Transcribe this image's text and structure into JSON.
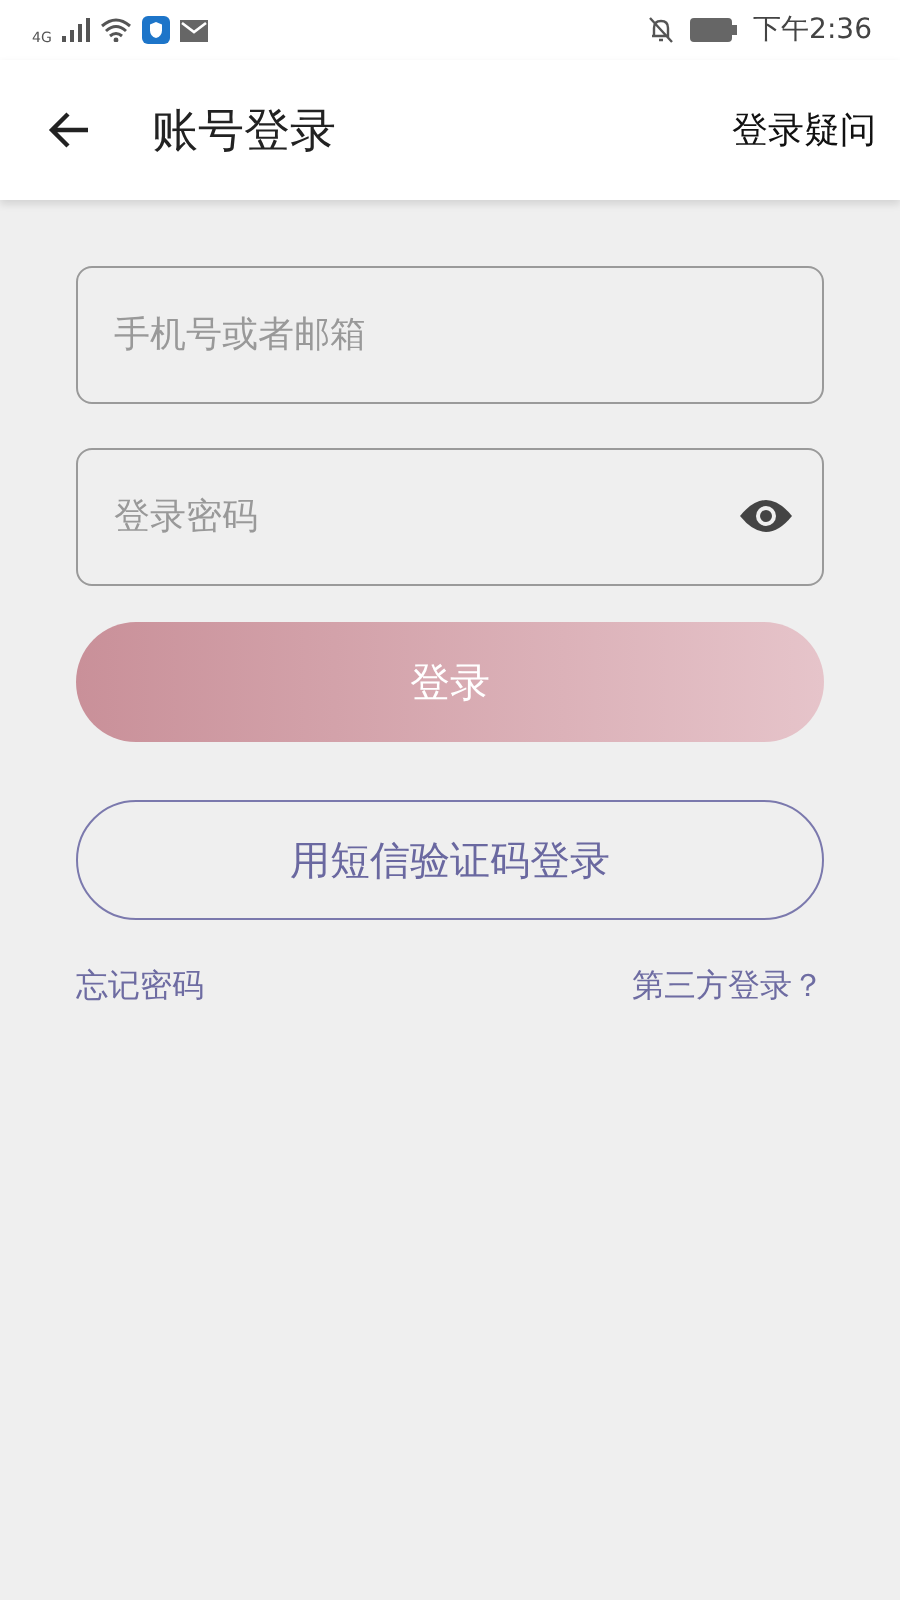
{
  "status_bar": {
    "network": "4G",
    "time": "下午2:36"
  },
  "app_bar": {
    "title": "账号登录",
    "action": "登录疑问"
  },
  "form": {
    "account": {
      "placeholder": "手机号或者邮箱"
    },
    "password": {
      "placeholder": "登录密码"
    },
    "login_button": {
      "label": "登录",
      "disabled": true
    },
    "sms_button": {
      "label": "用短信验证码登录"
    },
    "links": [
      {
        "label": "忘记密码"
      },
      {
        "label": "第三方登录？"
      }
    ]
  }
}
